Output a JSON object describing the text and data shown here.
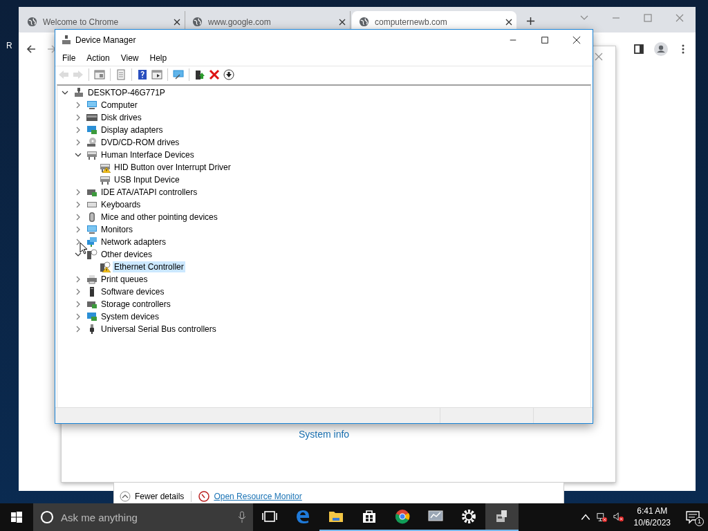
{
  "behind_text": "R",
  "chrome": {
    "tabs": [
      {
        "title": "Welcome to Chrome",
        "selected": false
      },
      {
        "title": "www.google.com",
        "selected": false
      },
      {
        "title": "computernewb.com",
        "selected": true
      }
    ]
  },
  "system_dialog": {
    "link": "System info"
  },
  "task_manager": {
    "fewer_details": "Fewer details",
    "resource_monitor": "Open Resource Monitor"
  },
  "device_manager": {
    "title": "Device Manager",
    "menu": [
      "File",
      "Action",
      "View",
      "Help"
    ],
    "toolbar": [
      {
        "kind": "back",
        "disabled": true
      },
      {
        "kind": "forward",
        "disabled": true
      },
      {
        "kind": "sep"
      },
      {
        "kind": "console",
        "disabled": false
      },
      {
        "kind": "sep"
      },
      {
        "kind": "properties",
        "disabled": false
      },
      {
        "kind": "sep"
      },
      {
        "kind": "help",
        "disabled": false
      },
      {
        "kind": "view",
        "disabled": false
      },
      {
        "kind": "sep"
      },
      {
        "kind": "scan",
        "disabled": false
      },
      {
        "kind": "sep"
      },
      {
        "kind": "update",
        "disabled": false
      },
      {
        "kind": "uninstall",
        "disabled": false
      },
      {
        "kind": "disable",
        "disabled": false
      }
    ],
    "tree": {
      "label": "DESKTOP-46G771P",
      "kind": "host",
      "expanded": true,
      "selected": false,
      "warning": false,
      "children": [
        {
          "label": "Computer",
          "kind": "monitor",
          "expanded": false,
          "selected": false,
          "warning": false
        },
        {
          "label": "Disk drives",
          "kind": "drive",
          "expanded": false,
          "selected": false,
          "warning": false
        },
        {
          "label": "Display adapters",
          "kind": "display",
          "expanded": false,
          "selected": false,
          "warning": false
        },
        {
          "label": "DVD/CD-ROM drives",
          "kind": "disc",
          "expanded": false,
          "selected": false,
          "warning": false
        },
        {
          "label": "Human Interface Devices",
          "kind": "hid",
          "expanded": true,
          "selected": false,
          "warning": false,
          "children": [
            {
              "label": "HID Button over Interrupt Driver",
              "kind": "hid",
              "selected": false,
              "warning": true
            },
            {
              "label": "USB Input Device",
              "kind": "hid",
              "selected": false,
              "warning": false
            }
          ]
        },
        {
          "label": "IDE ATA/ATAPI controllers",
          "kind": "chip",
          "expanded": false,
          "selected": false,
          "warning": false
        },
        {
          "label": "Keyboards",
          "kind": "keyboard",
          "expanded": false,
          "selected": false,
          "warning": false
        },
        {
          "label": "Mice and other pointing devices",
          "kind": "mouse",
          "expanded": false,
          "selected": false,
          "warning": false
        },
        {
          "label": "Monitors",
          "kind": "monitor",
          "expanded": false,
          "selected": false,
          "warning": false
        },
        {
          "label": "Network adapters",
          "kind": "network",
          "expanded": false,
          "selected": false,
          "warning": false
        },
        {
          "label": "Other devices",
          "kind": "unknown",
          "expanded": true,
          "selected": false,
          "warning": false,
          "children": [
            {
              "label": "Ethernet Controller",
              "kind": "unknown",
              "selected": true,
              "warning": true
            }
          ]
        },
        {
          "label": "Print queues",
          "kind": "printer",
          "expanded": false,
          "selected": false,
          "warning": false
        },
        {
          "label": "Software devices",
          "kind": "software",
          "expanded": false,
          "selected": false,
          "warning": false
        },
        {
          "label": "Storage controllers",
          "kind": "chip",
          "expanded": false,
          "selected": false,
          "warning": false
        },
        {
          "label": "System devices",
          "kind": "display",
          "expanded": false,
          "selected": false,
          "warning": false
        },
        {
          "label": "Universal Serial Bus controllers",
          "kind": "usb",
          "expanded": false,
          "selected": false,
          "warning": false
        }
      ]
    }
  },
  "taskbar": {
    "search": {
      "placeholder": "Ask me anything"
    },
    "apps": [
      {
        "kind": "taskview",
        "running": false,
        "selected": false
      },
      {
        "kind": "edge",
        "running": false,
        "selected": false
      },
      {
        "kind": "folder",
        "running": true,
        "selected": false
      },
      {
        "kind": "store",
        "running": true,
        "selected": false
      },
      {
        "kind": "chrome",
        "running": true,
        "selected": false
      },
      {
        "kind": "monitor",
        "running": true,
        "selected": false
      },
      {
        "kind": "settings",
        "running": true,
        "selected": false
      },
      {
        "kind": "devices",
        "running": true,
        "selected": true
      }
    ],
    "time": "6:41 AM",
    "date": "10/6/2023",
    "notifications": "1"
  }
}
